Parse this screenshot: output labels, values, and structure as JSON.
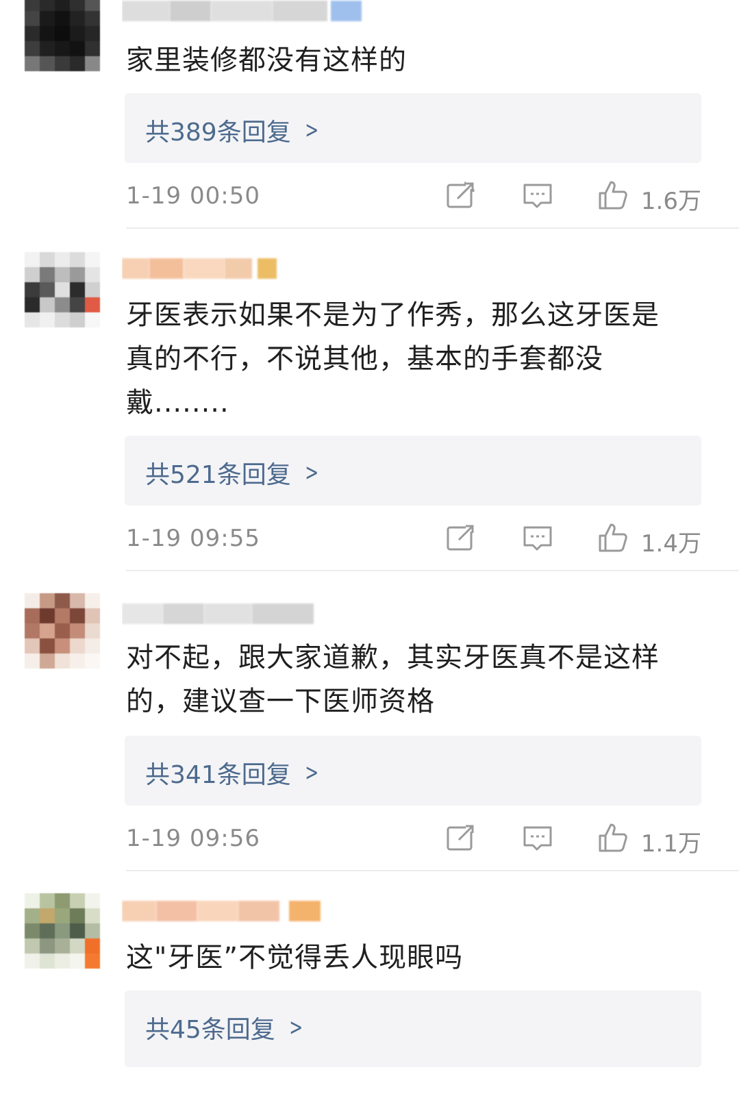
{
  "comments": [
    {
      "content": "家里装修都没有这样的",
      "replies_label": "共389条回复",
      "timestamp": "1-19 00:50",
      "likes": "1.6万"
    },
    {
      "content": "牙医表示如果不是为了作秀，那么这牙医是真的不行，不说其他，基本的手套都没戴........",
      "replies_label": "共521条回复",
      "timestamp": "1-19 09:55",
      "likes": "1.4万"
    },
    {
      "content": "对不起，跟大家道歉，其实牙医真不是这样的，建议查一下医师资格",
      "replies_label": "共341条回复",
      "timestamp": "1-19 09:56",
      "likes": "1.1万"
    },
    {
      "content": "这\"牙医”不觉得丢人现眼吗",
      "replies_label": "共45条回复"
    }
  ],
  "icons": {
    "share": "share-icon",
    "comment": "comment-icon",
    "like": "thumbs-up-icon",
    "reply_arrow": "chevron-right-icon"
  },
  "colors": {
    "reply_link": "#4d6a8e",
    "meta_text": "#8a8a8a",
    "reply_box_bg": "#f4f4f6"
  }
}
